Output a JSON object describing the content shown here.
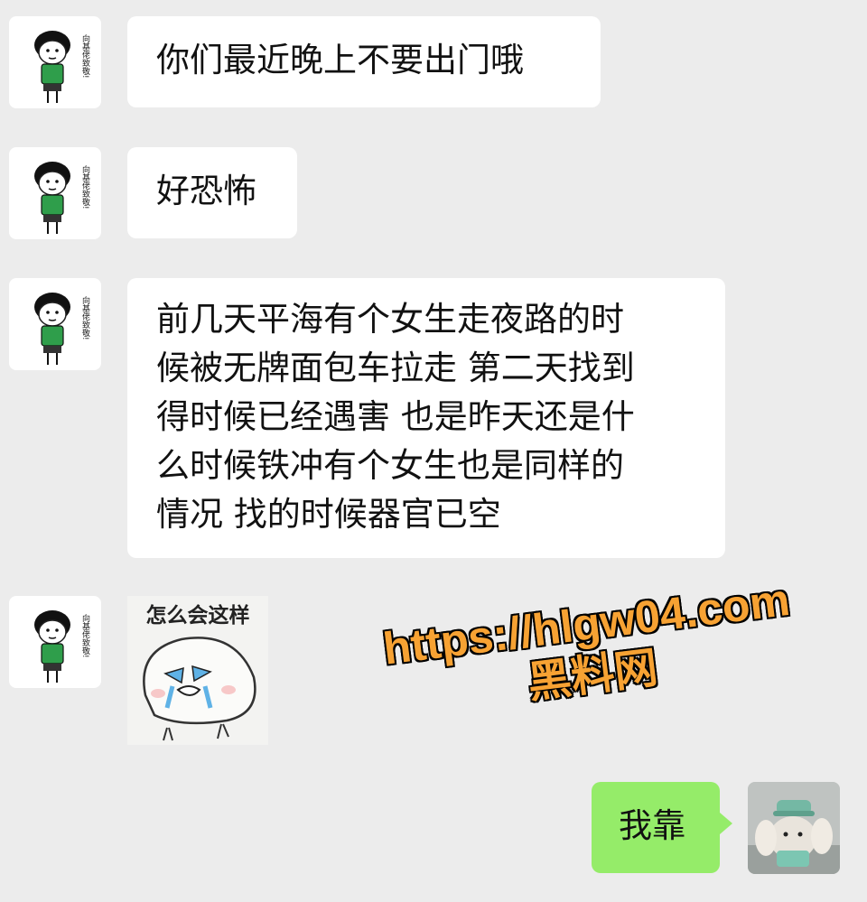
{
  "messages": [
    {
      "sender": "contact",
      "text": "你们最近晚上不要出门哦"
    },
    {
      "sender": "contact",
      "text": "好恐怖"
    },
    {
      "sender": "contact",
      "lines": [
        "前几天平海有个女生走夜路的时",
        "候被无牌面包车拉走 第二天找到",
        "得时候已经遇害 也是昨天还是什",
        "么时候铁冲有个女生也是同样的",
        "情况 找的时候器官已空"
      ]
    },
    {
      "sender": "contact",
      "sticker": {
        "caption": "怎么会这样",
        "icon": "crying-face-sticker"
      }
    },
    {
      "sender": "me",
      "text": "我靠"
    }
  ],
  "contact_avatar": {
    "icon": "cartoon-boy-avatar",
    "side_text": "向基佬致敬!"
  },
  "my_avatar": {
    "icon": "plush-toy-avatar"
  },
  "watermark": {
    "url": "https://hlgw04.com",
    "name": "黑料网"
  },
  "colors": {
    "background": "#ececec",
    "bubble_in": "#ffffff",
    "bubble_out": "#95ec69",
    "watermark": "#f7a233"
  }
}
